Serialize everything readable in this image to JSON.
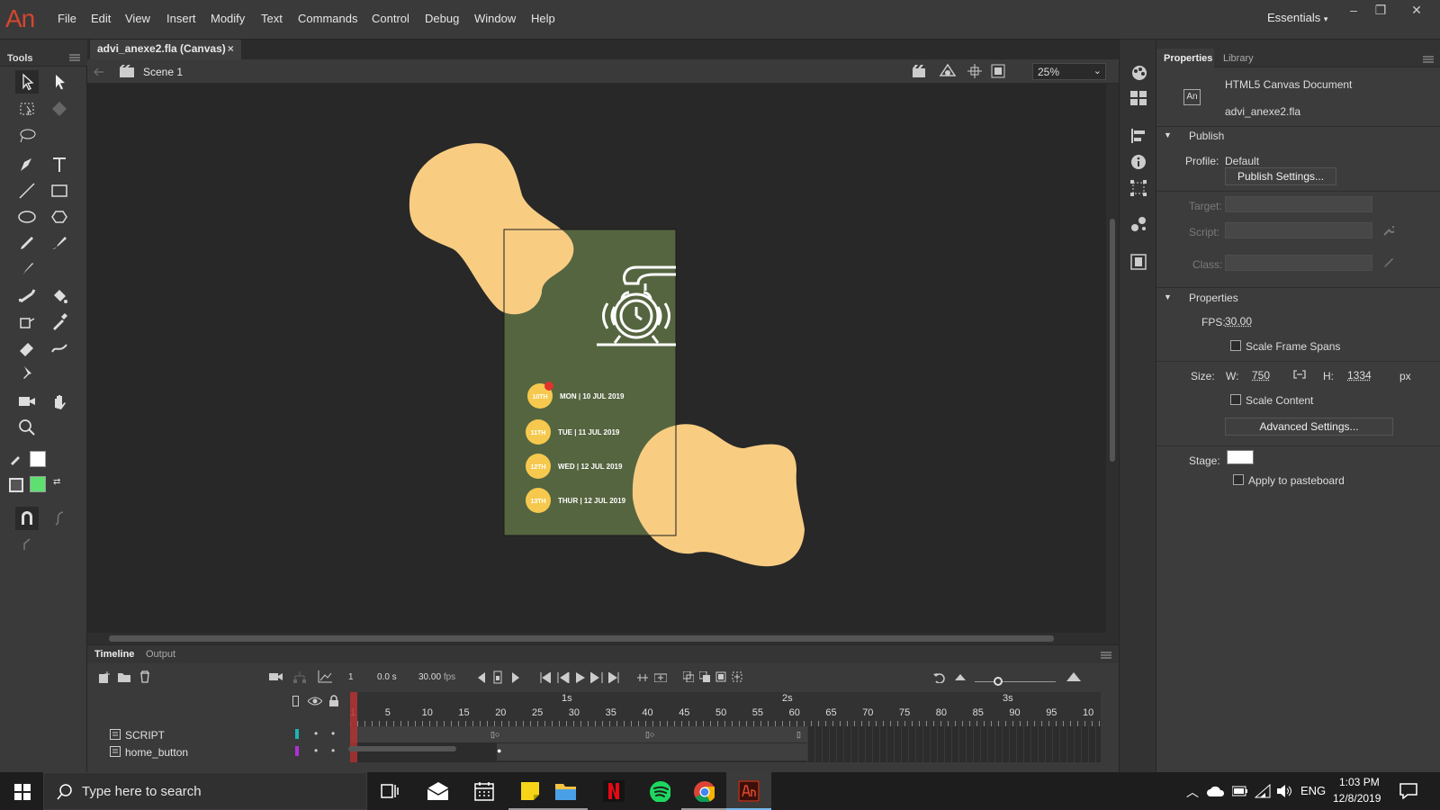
{
  "app": {
    "logo": "An",
    "workspace": "Essentials"
  },
  "menu": [
    "File",
    "Edit",
    "View",
    "Insert",
    "Modify",
    "Text",
    "Commands",
    "Control",
    "Debug",
    "Window",
    "Help"
  ],
  "window_buttons": [
    "–",
    "❐",
    "✕"
  ],
  "tools_panel": {
    "title": "Tools"
  },
  "document": {
    "tab_label": "advi_anexe2.fla (Canvas)",
    "close": "×",
    "scene": "Scene 1",
    "zoom": "25%"
  },
  "stage_content": {
    "dates": [
      {
        "badge": "10TH",
        "label": "MON | 10 JUL 2019"
      },
      {
        "badge": "11TH",
        "label": "TUE | 11 JUL 2019"
      },
      {
        "badge": "12TH",
        "label": "WED | 12 JUL 2019"
      },
      {
        "badge": "13TH",
        "label": "THUR | 12 JUL 2019"
      }
    ],
    "colors": {
      "blob": "#f8cd82",
      "card": "#556540",
      "badge": "#f6c94e",
      "alert_dot": "#e0332b"
    }
  },
  "timeline": {
    "tabs": [
      "Timeline",
      "Output"
    ],
    "frame": "1",
    "time": "0.0 s",
    "fps": "30.00",
    "fps_unit": "fps",
    "seconds": [
      "1s",
      "2s",
      "3s"
    ],
    "ruler": [
      "1",
      "5",
      "10",
      "15",
      "20",
      "25",
      "30",
      "35",
      "40",
      "45",
      "50",
      "55",
      "60",
      "65",
      "70",
      "75",
      "80",
      "85",
      "90",
      "95",
      "10"
    ],
    "layers": [
      {
        "name": "SCRIPT",
        "color": "#1fb3b3"
      },
      {
        "name": "home_button",
        "color": "#b02fd8"
      }
    ]
  },
  "properties": {
    "tabs": [
      "Properties",
      "Library"
    ],
    "doc_type": "HTML5 Canvas Document",
    "doc_name": "advi_anexe2.fla",
    "publish": {
      "section": "Publish",
      "profile_label": "Profile:",
      "profile_value": "Default",
      "settings_button": "Publish Settings...",
      "target_label": "Target:",
      "script_label": "Script:",
      "class_label": "Class:"
    },
    "props": {
      "section": "Properties",
      "fps_label": "FPS:",
      "fps_value": "30.00",
      "scale_frame_spans": "Scale Frame Spans",
      "size_label": "Size:",
      "w_label": "W:",
      "w_value": "750",
      "h_label": "H:",
      "h_value": "1334",
      "unit": "px",
      "scale_content": "Scale Content",
      "advanced_button": "Advanced Settings...",
      "stage_label": "Stage:",
      "apply_pasteboard": "Apply to pasteboard"
    }
  },
  "taskbar": {
    "search_placeholder": "Type here to search",
    "lang": "ENG",
    "time": "1:03 PM",
    "date": "12/8/2019"
  }
}
